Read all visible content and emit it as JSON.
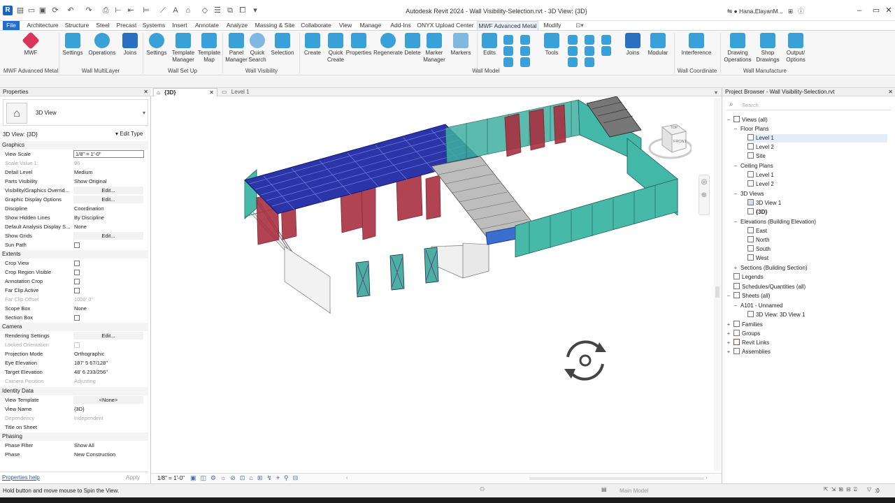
{
  "title": "Autodesk Revit 2024 - Wall Visibility-Selection.rvt - 3D View: {3D}",
  "user": "Hana.ElayanM...",
  "tabs": [
    "File",
    "Architecture",
    "Structure",
    "Steel",
    "Precast",
    "Systems",
    "Insert",
    "Annotate",
    "Analyze",
    "Massing & Site",
    "Collaborate",
    "View",
    "Manage",
    "Add-Ins",
    "ONYX Upload Center",
    "MWF Advanced Metal",
    "Modify"
  ],
  "ribbon": {
    "buttons": {
      "mwf": "MWF",
      "settings1": "Settings",
      "operations": "Operations",
      "joins1": "Joins",
      "settings2": "Settings",
      "template_manager": "Template\nManager",
      "template_map": "Template\nMap",
      "panel_manager": "Panel\nManager",
      "quick_search": "Quick\nSearch",
      "selection": "Selection",
      "create": "Create",
      "quick_create": "Quick\nCreate",
      "properties": "Properties",
      "regenerate": "Regenerate",
      "delete": "Delete",
      "marker_manager": "Marker\nManager",
      "markers": "Markers",
      "edits": "Edits",
      "tools": "Tools",
      "joins2": "Joins",
      "modular": "Modular",
      "interference": "Interference",
      "drawing_operations": "Drawing\nOperations",
      "shop_drawings": "Shop\nDrawings",
      "output_options": "Output/\nOptions"
    },
    "panels": {
      "p1": "MWF Advanced Metal",
      "p2": "Wall MultiLayer",
      "p3": "Wall Set Up",
      "p4": "Wall Visibility",
      "p5": "Wall Model",
      "p6": "Wall Coordinate",
      "p7": "Wall Manufacture"
    }
  },
  "properties": {
    "header": "Properties",
    "type_name": "3D View",
    "selector": "3D View: {3D}",
    "edit_type": "Edit Type",
    "sections": {
      "graphics": "Graphics",
      "extents": "Extents",
      "camera": "Camera",
      "identity": "Identity Data",
      "phasing": "Phasing"
    },
    "rows": {
      "view_scale_k": "View Scale",
      "view_scale_v": "1/8\" = 1'-0\"",
      "scale_value_k": "Scale Value    1:",
      "scale_value_v": "96",
      "detail_level_k": "Detail Level",
      "detail_level_v": "Medium",
      "parts_vis_k": "Parts Visibility",
      "parts_vis_v": "Show Original",
      "vg_k": "Visibility/Graphics Overrid...",
      "edit": "Edit...",
      "gdo_k": "Graphic Display Options",
      "discipline_k": "Discipline",
      "discipline_v": "Coordination",
      "hidden_k": "Show Hidden Lines",
      "hidden_v": "By Discipline",
      "analysis_k": "Default Analysis Display S...",
      "analysis_v": "None",
      "grids_k": "Show Grids",
      "sun_k": "Sun Path",
      "crop_k": "Crop View",
      "crop_vis_k": "Crop Region Visible",
      "ann_crop_k": "Annotation Crop",
      "far_clip_k": "Far Clip Active",
      "far_off_k": "Far Clip Offset",
      "far_off_v": "1000'  0\"",
      "scope_k": "Scope Box",
      "scope_v": "None",
      "section_k": "Section Box",
      "render_k": "Rendering Settings",
      "locked_k": "Locked Orientation",
      "proj_k": "Projection Mode",
      "proj_v": "Orthographic",
      "eye_k": "Eye Elevation",
      "eye_v": "187'  5 67/128\"",
      "target_k": "Target Elevation",
      "target_v": "48'  6 233/256\"",
      "campos_k": "Camera Position",
      "campos_v": "Adjusting",
      "template_k": "View Template",
      "template_v": "<None>",
      "viewname_k": "View Name",
      "viewname_v": "{3D}",
      "dep_k": "Dependency",
      "dep_v": "Independent",
      "tos_k": "Title on Sheet",
      "phasefilter_k": "Phase Filter",
      "phasefilter_v": "Show All",
      "phase_k": "Phase",
      "phase_v": "New Construction"
    },
    "help": "Properties help",
    "apply": "Apply"
  },
  "view": {
    "tab_active": "{3D}",
    "tab_other": "Level 1",
    "scale": "1/8\" = 1'-0\"",
    "cube_top": "TOP",
    "cube_front": "FRONT"
  },
  "browser": {
    "header": "Project Browser - Wall Visibility-Selection.rvt",
    "search": "Search",
    "nodes": {
      "views": "Views (all)",
      "floor_plans": "Floor Plans",
      "fp_l1": "Level 1",
      "fp_l2": "Level 2",
      "fp_site": "Site",
      "ceiling_plans": "Ceiling Plans",
      "cp_l1": "Level 1",
      "cp_l2": "Level 2",
      "views3d": "3D Views",
      "v3d_1": "3D View 1",
      "v3d_2": "{3D}",
      "elevations": "Elevations (Building Elevation)",
      "east": "East",
      "north": "North",
      "south": "South",
      "west": "West",
      "sections": "Sections (Building Section)",
      "legends": "Legends",
      "schedules": "Schedules/Quantities (all)",
      "sheets": "Sheets (all)",
      "a101": "A101 - Unnamed",
      "a101_view": "3D View: 3D View 1",
      "families": "Families",
      "groups": "Groups",
      "revit_links": "Revit Links",
      "assemblies": "Assemblies"
    }
  },
  "status": {
    "message": "Hold button and move mouse to Spin the View.",
    "model": "Main Model",
    "zero": ":0"
  }
}
